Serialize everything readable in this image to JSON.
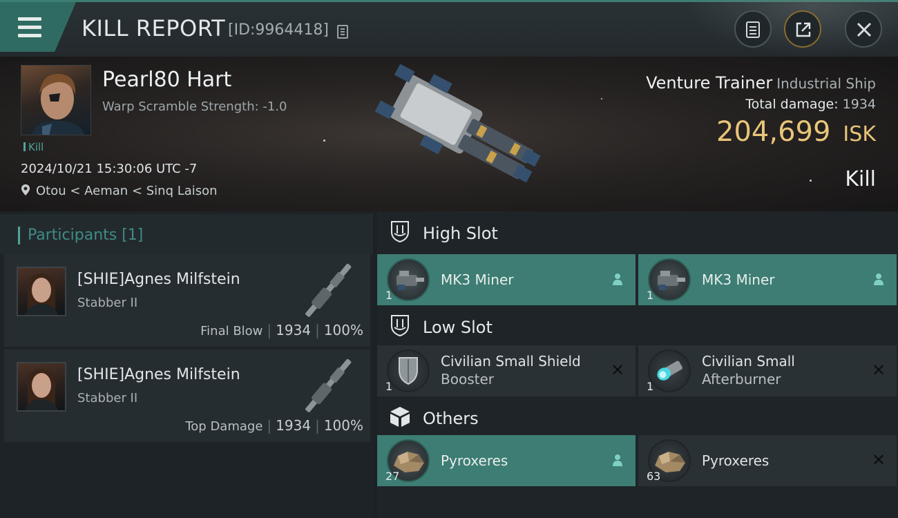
{
  "header": {
    "title": "KILL REPORT",
    "report_id": "[ID:9964418]"
  },
  "banner": {
    "pilot_name": "Pearl80 Hart",
    "warp_scramble": "Warp Scramble Strength: -1.0",
    "kill_tag": "Kill",
    "datetime": "2024/10/21 15:30:06 UTC -7",
    "location": "Otou < Aeman < Sinq Laison",
    "ship_name": "Venture Trainer",
    "ship_class": "Industrial Ship",
    "total_damage_label": "Total damage:",
    "total_damage_value": "1934",
    "isk_value": "204,699",
    "isk_unit": "ISK",
    "result": "Kill"
  },
  "participants": {
    "title": "Participants [1]",
    "rows": [
      {
        "name": "[SHIE]Agnes Milfstein",
        "ship": "Stabber II",
        "role": "Final Blow",
        "damage": "1934",
        "percent": "100%"
      },
      {
        "name": "[SHIE]Agnes Milfstein",
        "ship": "Stabber II",
        "role": "Top Damage",
        "damage": "1934",
        "percent": "100%"
      }
    ]
  },
  "fitting": {
    "high_slot": {
      "title": "High Slot",
      "items": [
        {
          "name_line1": "MK3 Miner",
          "name_line2": "",
          "qty": "1",
          "status": "dropped"
        },
        {
          "name_line1": "MK3 Miner",
          "name_line2": "",
          "qty": "1",
          "status": "dropped"
        }
      ]
    },
    "low_slot": {
      "title": "Low Slot",
      "items": [
        {
          "name_line1": "Civilian Small Shield",
          "name_line2": "Booster",
          "qty": "1",
          "status": "destroyed"
        },
        {
          "name_line1": "Civilian Small",
          "name_line2": "Afterburner",
          "qty": "1",
          "status": "destroyed"
        }
      ]
    },
    "others": {
      "title": "Others",
      "items": [
        {
          "name_line1": "Pyroxeres",
          "name_line2": "",
          "qty": "27",
          "status": "dropped"
        },
        {
          "name_line1": "Pyroxeres",
          "name_line2": "",
          "qty": "63",
          "status": "destroyed"
        }
      ]
    }
  },
  "colors": {
    "accent_teal": "#3d7d73",
    "isk_gold": "#e8c579",
    "participants_title": "#3f8c83"
  }
}
